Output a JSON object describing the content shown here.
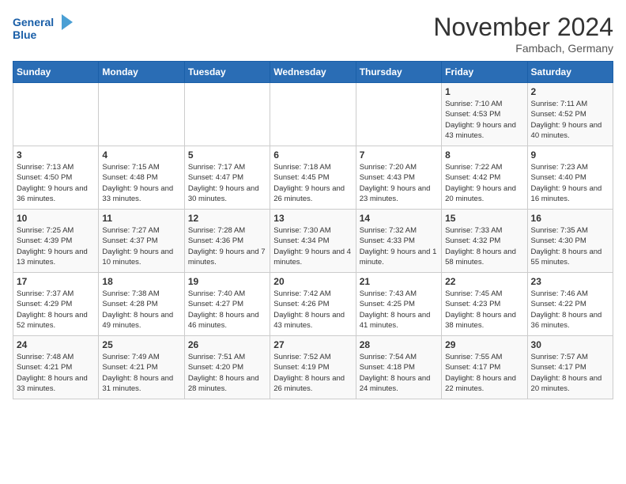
{
  "header": {
    "logo_line1": "General",
    "logo_line2": "Blue",
    "month_title": "November 2024",
    "location": "Fambach, Germany"
  },
  "days_of_week": [
    "Sunday",
    "Monday",
    "Tuesday",
    "Wednesday",
    "Thursday",
    "Friday",
    "Saturday"
  ],
  "weeks": [
    [
      {
        "day": "",
        "info": ""
      },
      {
        "day": "",
        "info": ""
      },
      {
        "day": "",
        "info": ""
      },
      {
        "day": "",
        "info": ""
      },
      {
        "day": "",
        "info": ""
      },
      {
        "day": "1",
        "info": "Sunrise: 7:10 AM\nSunset: 4:53 PM\nDaylight: 9 hours and 43 minutes."
      },
      {
        "day": "2",
        "info": "Sunrise: 7:11 AM\nSunset: 4:52 PM\nDaylight: 9 hours and 40 minutes."
      }
    ],
    [
      {
        "day": "3",
        "info": "Sunrise: 7:13 AM\nSunset: 4:50 PM\nDaylight: 9 hours and 36 minutes."
      },
      {
        "day": "4",
        "info": "Sunrise: 7:15 AM\nSunset: 4:48 PM\nDaylight: 9 hours and 33 minutes."
      },
      {
        "day": "5",
        "info": "Sunrise: 7:17 AM\nSunset: 4:47 PM\nDaylight: 9 hours and 30 minutes."
      },
      {
        "day": "6",
        "info": "Sunrise: 7:18 AM\nSunset: 4:45 PM\nDaylight: 9 hours and 26 minutes."
      },
      {
        "day": "7",
        "info": "Sunrise: 7:20 AM\nSunset: 4:43 PM\nDaylight: 9 hours and 23 minutes."
      },
      {
        "day": "8",
        "info": "Sunrise: 7:22 AM\nSunset: 4:42 PM\nDaylight: 9 hours and 20 minutes."
      },
      {
        "day": "9",
        "info": "Sunrise: 7:23 AM\nSunset: 4:40 PM\nDaylight: 9 hours and 16 minutes."
      }
    ],
    [
      {
        "day": "10",
        "info": "Sunrise: 7:25 AM\nSunset: 4:39 PM\nDaylight: 9 hours and 13 minutes."
      },
      {
        "day": "11",
        "info": "Sunrise: 7:27 AM\nSunset: 4:37 PM\nDaylight: 9 hours and 10 minutes."
      },
      {
        "day": "12",
        "info": "Sunrise: 7:28 AM\nSunset: 4:36 PM\nDaylight: 9 hours and 7 minutes."
      },
      {
        "day": "13",
        "info": "Sunrise: 7:30 AM\nSunset: 4:34 PM\nDaylight: 9 hours and 4 minutes."
      },
      {
        "day": "14",
        "info": "Sunrise: 7:32 AM\nSunset: 4:33 PM\nDaylight: 9 hours and 1 minute."
      },
      {
        "day": "15",
        "info": "Sunrise: 7:33 AM\nSunset: 4:32 PM\nDaylight: 8 hours and 58 minutes."
      },
      {
        "day": "16",
        "info": "Sunrise: 7:35 AM\nSunset: 4:30 PM\nDaylight: 8 hours and 55 minutes."
      }
    ],
    [
      {
        "day": "17",
        "info": "Sunrise: 7:37 AM\nSunset: 4:29 PM\nDaylight: 8 hours and 52 minutes."
      },
      {
        "day": "18",
        "info": "Sunrise: 7:38 AM\nSunset: 4:28 PM\nDaylight: 8 hours and 49 minutes."
      },
      {
        "day": "19",
        "info": "Sunrise: 7:40 AM\nSunset: 4:27 PM\nDaylight: 8 hours and 46 minutes."
      },
      {
        "day": "20",
        "info": "Sunrise: 7:42 AM\nSunset: 4:26 PM\nDaylight: 8 hours and 43 minutes."
      },
      {
        "day": "21",
        "info": "Sunrise: 7:43 AM\nSunset: 4:25 PM\nDaylight: 8 hours and 41 minutes."
      },
      {
        "day": "22",
        "info": "Sunrise: 7:45 AM\nSunset: 4:23 PM\nDaylight: 8 hours and 38 minutes."
      },
      {
        "day": "23",
        "info": "Sunrise: 7:46 AM\nSunset: 4:22 PM\nDaylight: 8 hours and 36 minutes."
      }
    ],
    [
      {
        "day": "24",
        "info": "Sunrise: 7:48 AM\nSunset: 4:21 PM\nDaylight: 8 hours and 33 minutes."
      },
      {
        "day": "25",
        "info": "Sunrise: 7:49 AM\nSunset: 4:21 PM\nDaylight: 8 hours and 31 minutes."
      },
      {
        "day": "26",
        "info": "Sunrise: 7:51 AM\nSunset: 4:20 PM\nDaylight: 8 hours and 28 minutes."
      },
      {
        "day": "27",
        "info": "Sunrise: 7:52 AM\nSunset: 4:19 PM\nDaylight: 8 hours and 26 minutes."
      },
      {
        "day": "28",
        "info": "Sunrise: 7:54 AM\nSunset: 4:18 PM\nDaylight: 8 hours and 24 minutes."
      },
      {
        "day": "29",
        "info": "Sunrise: 7:55 AM\nSunset: 4:17 PM\nDaylight: 8 hours and 22 minutes."
      },
      {
        "day": "30",
        "info": "Sunrise: 7:57 AM\nSunset: 4:17 PM\nDaylight: 8 hours and 20 minutes."
      }
    ]
  ]
}
